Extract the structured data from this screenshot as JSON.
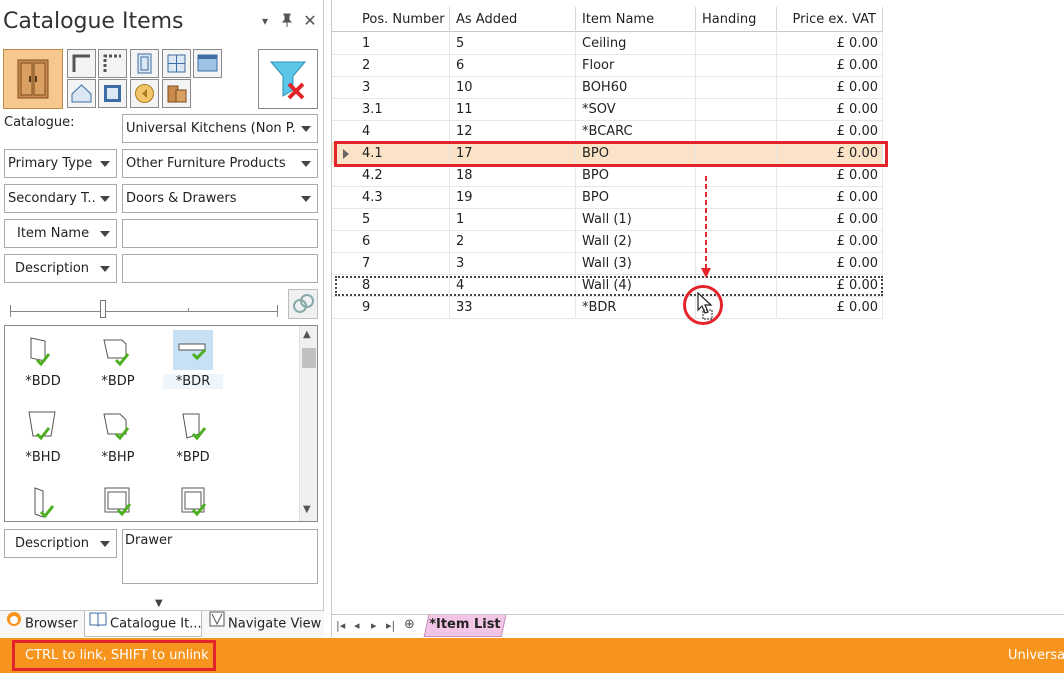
{
  "panel": {
    "title": "Catalogue Items"
  },
  "filters": {
    "catalogue_label": "Catalogue:",
    "catalogue_value": "Universal Kitchens (Non P...",
    "primary_type_label": "Primary Type",
    "primary_type_value": "Other Furniture Products",
    "secondary_type_label": "Secondary T...",
    "secondary_type_value": "Doors & Drawers",
    "item_name_label": "Item Name",
    "item_name_value": "",
    "description_label": "Description",
    "description_value": ""
  },
  "gallery": {
    "items": [
      {
        "name": "*BDD",
        "icon": "door-icon"
      },
      {
        "name": "*BDP",
        "icon": "door-panel-icon"
      },
      {
        "name": "*BDR",
        "icon": "drawer-front-icon"
      },
      {
        "name": "*BHD",
        "icon": "hinged-door-icon"
      },
      {
        "name": "*BHP",
        "icon": "hinged-panel-icon"
      },
      {
        "name": "*BPD",
        "icon": "panel-door-icon"
      },
      {
        "name": "",
        "icon": "side-panel-icon"
      },
      {
        "name": "",
        "icon": "box-icon"
      },
      {
        "name": "",
        "icon": "box-icon"
      }
    ]
  },
  "detail": {
    "description_label": "Description",
    "description_value": "Drawer"
  },
  "panel_tabs": [
    {
      "label": "Browser"
    },
    {
      "label": "Catalogue It..."
    },
    {
      "label": "Navigate View"
    }
  ],
  "grid": {
    "columns": [
      "Pos. Number",
      "As Added",
      "Item Name",
      "Handing",
      "Price ex. VAT"
    ],
    "rows": [
      [
        "1",
        "5",
        "Ceiling",
        "",
        "£ 0.00"
      ],
      [
        "2",
        "6",
        "Floor",
        "",
        "£ 0.00"
      ],
      [
        "3",
        "10",
        "BOH60",
        "",
        "£ 0.00"
      ],
      [
        "3.1",
        "11",
        "*SOV",
        "",
        "£ 0.00"
      ],
      [
        "4",
        "12",
        "*BCARC",
        "",
        "£ 0.00"
      ],
      [
        "4.1",
        "17",
        "BPO",
        "",
        "£ 0.00"
      ],
      [
        "4.2",
        "18",
        "BPO",
        "",
        "£ 0.00"
      ],
      [
        "4.3",
        "19",
        "BPO",
        "",
        "£ 0.00"
      ],
      [
        "5",
        "1",
        "Wall (1)",
        "",
        "£ 0.00"
      ],
      [
        "6",
        "2",
        "Wall (2)",
        "",
        "£ 0.00"
      ],
      [
        "7",
        "3",
        "Wall (3)",
        "",
        "£ 0.00"
      ],
      [
        "8",
        "4",
        "Wall (4)",
        "",
        "£ 0.00"
      ],
      [
        "9",
        "33",
        "*BDR",
        "",
        "£ 0.00"
      ]
    ],
    "selected_row": 5,
    "drop_target_row": 11
  },
  "sheet": {
    "tab_label": "*Item List"
  },
  "status": {
    "message": "CTRL to link, SHIFT to unlink",
    "right_text": "Universal"
  },
  "colors": {
    "status_bar": "#f7941e",
    "selected_row": "#fbe3c8",
    "highlight": "#e3252b",
    "sheet_tab": "#f3c6e8"
  }
}
